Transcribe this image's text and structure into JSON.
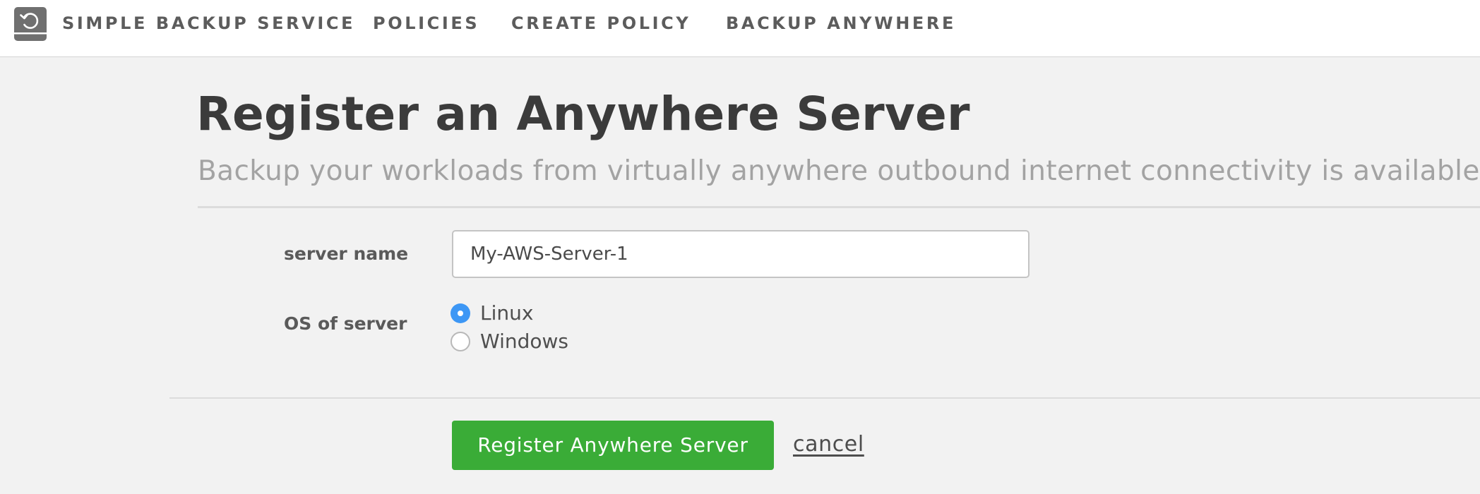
{
  "app": {
    "brand_name": "SIMPLE BACKUP SERVICE",
    "logo_icon": "backup-restore-icon"
  },
  "nav": {
    "items": [
      {
        "label": "POLICIES"
      },
      {
        "label": "CREATE POLICY"
      },
      {
        "label": "BACKUP ANYWHERE"
      }
    ]
  },
  "page": {
    "title": "Register an Anywhere Server",
    "subtitle": "Backup your workloads from virtually anywhere outbound internet connectivity is available"
  },
  "form": {
    "server_name": {
      "label": "server name",
      "value": "My-AWS-Server-1"
    },
    "os": {
      "label": "OS of server",
      "options": [
        {
          "label": "Linux",
          "selected": true
        },
        {
          "label": "Windows",
          "selected": false
        }
      ]
    },
    "submit_label": "Register Anywhere Server",
    "cancel_label": "cancel"
  },
  "colors": {
    "accent_blue": "#3d97f5",
    "submit_green": "#3aac37",
    "page_background": "#f2f2f2"
  }
}
